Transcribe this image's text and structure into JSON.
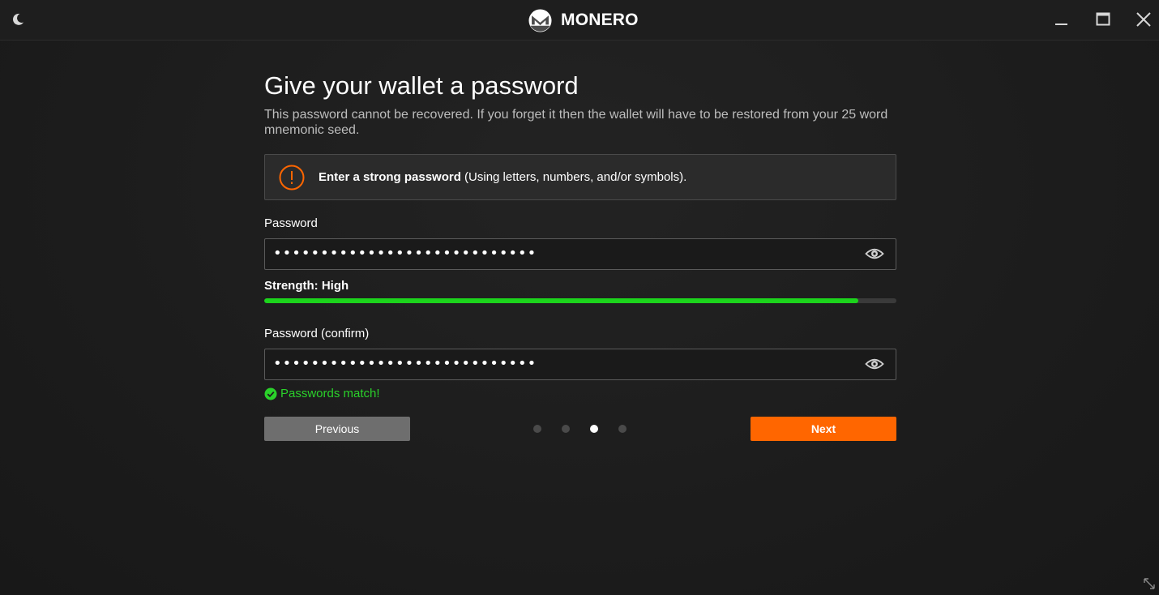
{
  "titlebar": {
    "brand_text": "MONERO",
    "theme_icon": "moon-icon",
    "window_controls": [
      "minimize-icon",
      "maximize-icon",
      "close-icon"
    ]
  },
  "page": {
    "title": "Give your wallet a password",
    "description": "This password cannot be recovered. If you forget it then the wallet will have to be restored from your 25 word mnemonic seed."
  },
  "warning": {
    "icon": "exclamation-circle-icon",
    "bold_text": "Enter a strong password",
    "rest_text": " (Using letters, numbers, and/or symbols)."
  },
  "password": {
    "label": "Password",
    "masked_value": "••••••••••••••••••••••••••••",
    "toggle_icon": "eye-icon"
  },
  "strength": {
    "label": "Strength: High",
    "level_fraction": 0.94,
    "color": "#1cd41c"
  },
  "confirm": {
    "label": "Password (confirm)",
    "masked_value": "••••••••••••••••••••••••••••",
    "toggle_icon": "eye-icon"
  },
  "match": {
    "icon": "check-circle-icon",
    "text": "Passwords match!",
    "color": "#2ad12a"
  },
  "navigation": {
    "previous_label": "Previous",
    "next_label": "Next",
    "step_count": 4,
    "current_step": 3
  },
  "colors": {
    "accent": "#ff6600",
    "background": "#1c1c1c"
  }
}
